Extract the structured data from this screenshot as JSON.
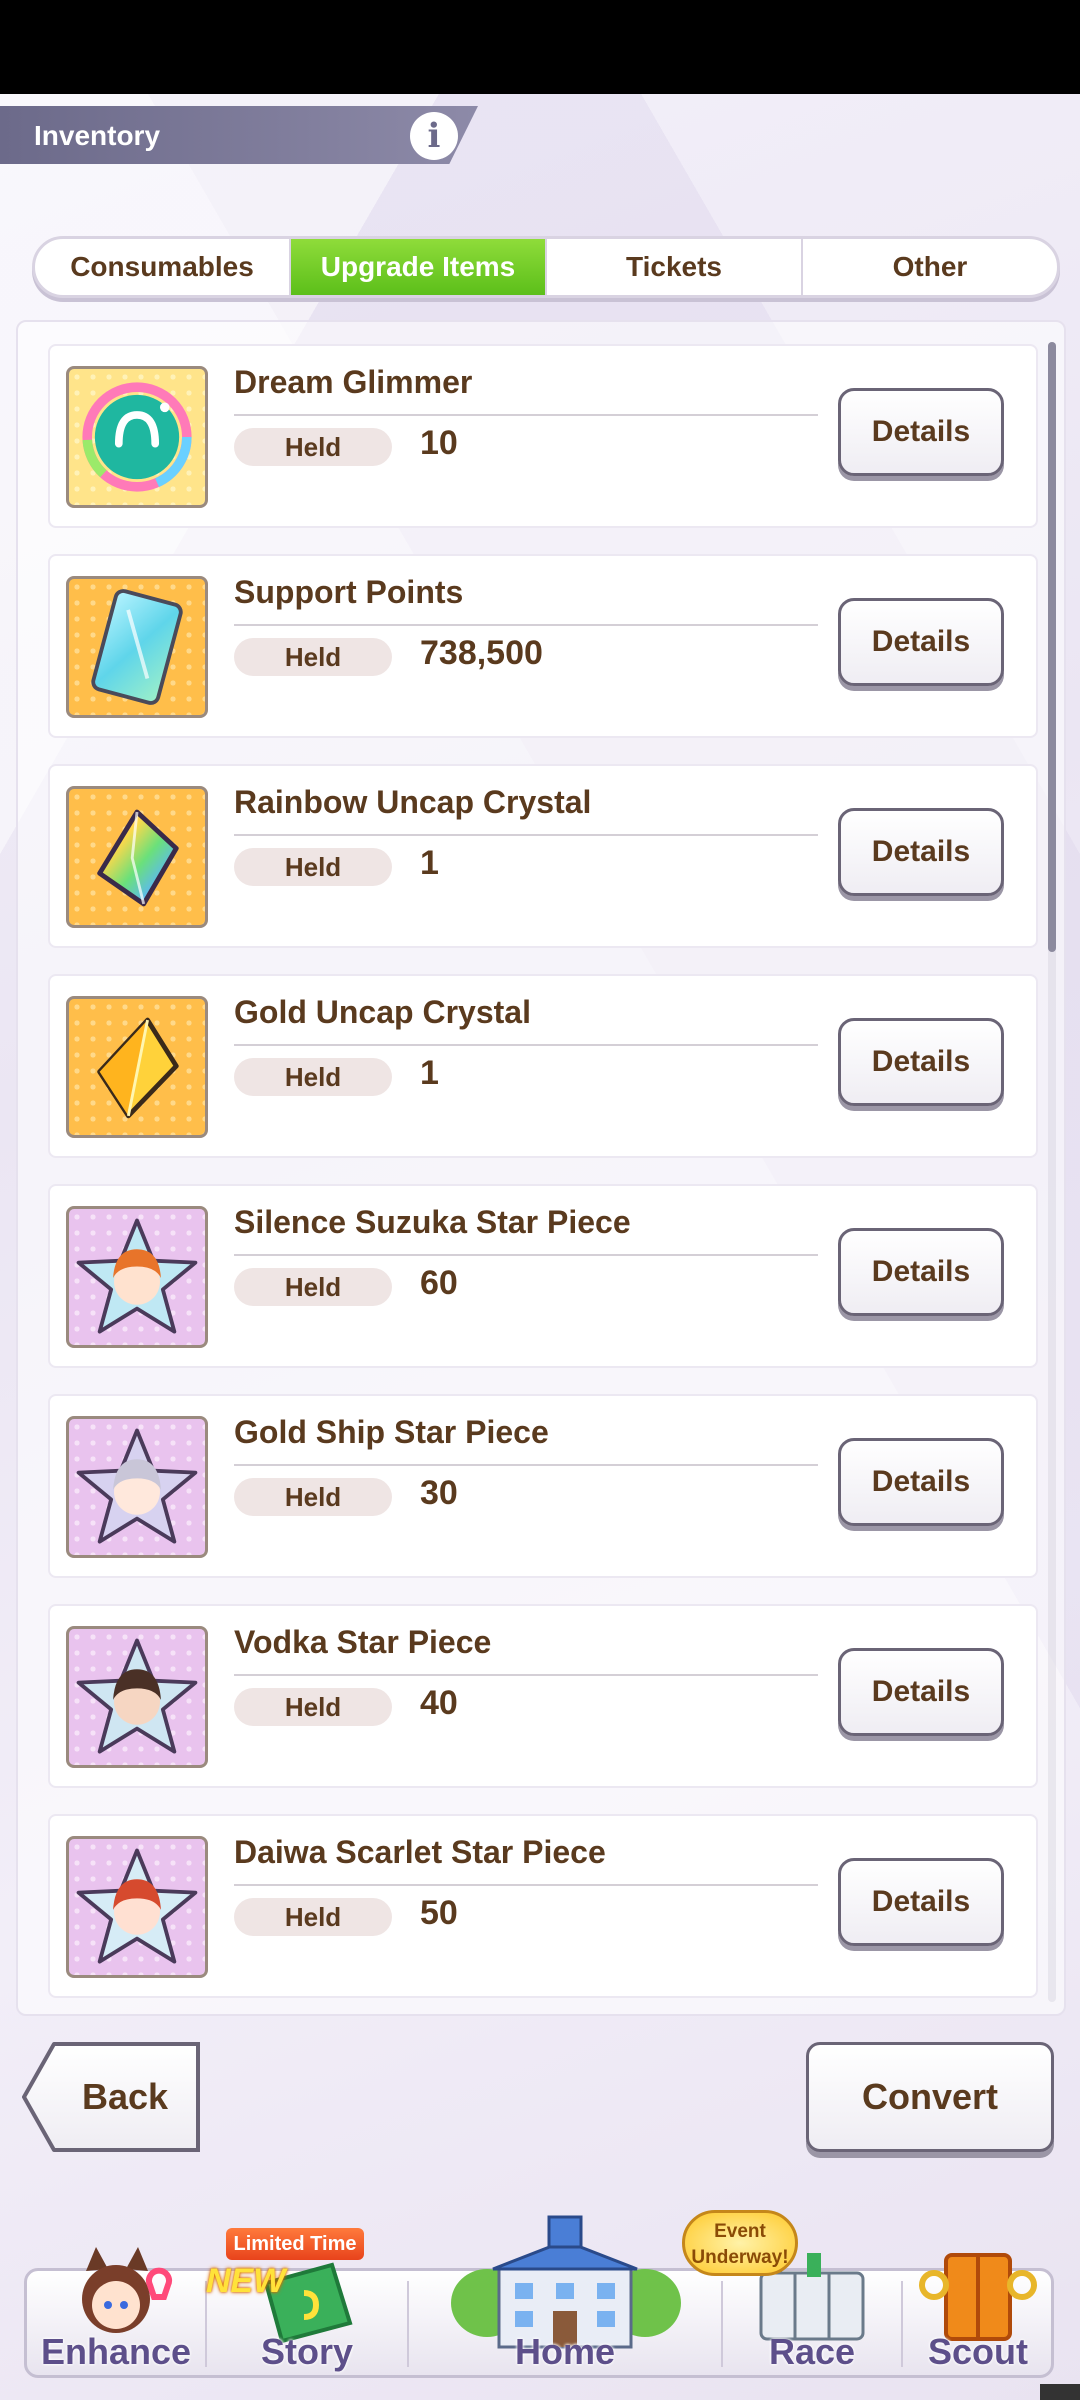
{
  "header": {
    "title": "Inventory",
    "info_symbol": "i"
  },
  "tabs": [
    {
      "label": "Consumables",
      "active": false
    },
    {
      "label": "Upgrade Items",
      "active": true
    },
    {
      "label": "Tickets",
      "active": false
    },
    {
      "label": "Other",
      "active": false
    }
  ],
  "held_label": "Held",
  "details_label": "Details",
  "items": [
    {
      "name": "Dream Glimmer",
      "held": "10",
      "icon": "dream-glimmer-icon"
    },
    {
      "name": "Support Points",
      "held": "738,500",
      "icon": "support-points-icon"
    },
    {
      "name": "Rainbow Uncap Crystal",
      "held": "1",
      "icon": "rainbow-crystal-icon"
    },
    {
      "name": "Gold Uncap Crystal",
      "held": "1",
      "icon": "gold-crystal-icon"
    },
    {
      "name": "Silence Suzuka Star Piece",
      "held": "60",
      "icon": "star-piece-icon"
    },
    {
      "name": "Gold Ship Star Piece",
      "held": "30",
      "icon": "star-piece-icon"
    },
    {
      "name": "Vodka Star Piece",
      "held": "40",
      "icon": "star-piece-icon"
    },
    {
      "name": "Daiwa Scarlet Star Piece",
      "held": "50",
      "icon": "star-piece-icon"
    }
  ],
  "buttons": {
    "back": "Back",
    "convert": "Convert"
  },
  "nav": [
    {
      "label": "Enhance"
    },
    {
      "label": "Story"
    },
    {
      "label": "Home"
    },
    {
      "label": "Race"
    },
    {
      "label": "Scout"
    }
  ],
  "badges": {
    "story_new": "NEW",
    "story_limited": "Limited Time",
    "race_event_line1": "Event",
    "race_event_line2": "Underway!"
  }
}
